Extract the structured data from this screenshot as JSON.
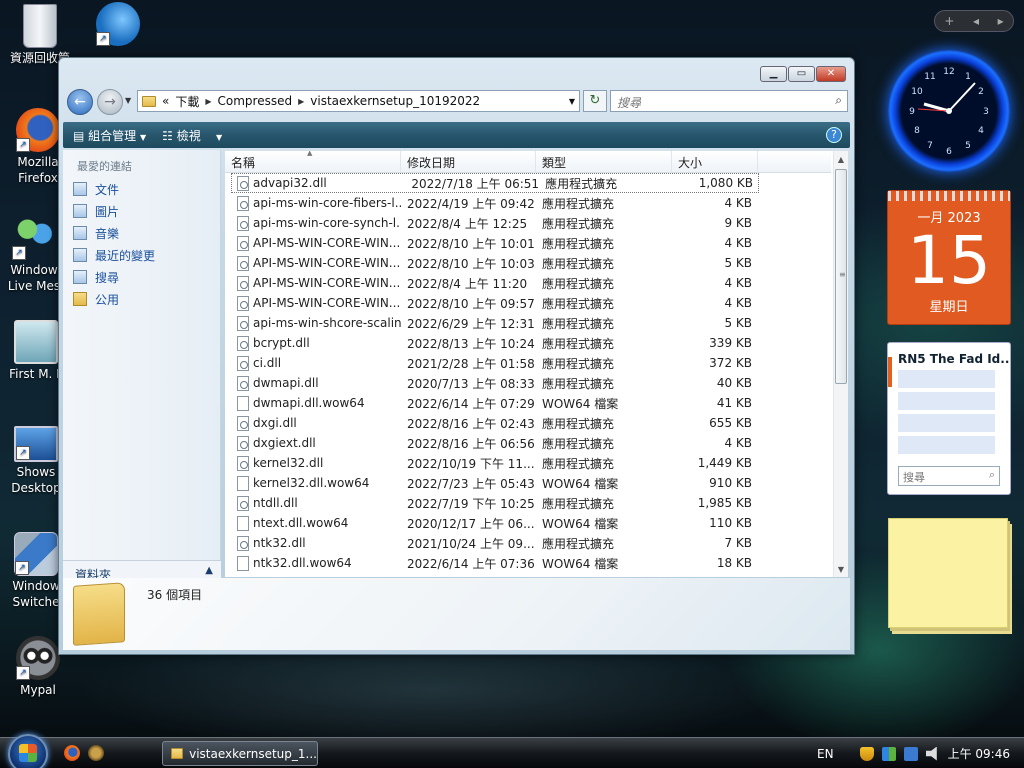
{
  "desktop": {
    "icons": [
      {
        "label": "資源回收筒",
        "icon": "recycle-bin-icon"
      },
      {
        "label": "",
        "icon": "internet-download-manager-icon"
      },
      {
        "label": "Mozilla\nFirefox",
        "icon": "firefox-icon"
      },
      {
        "label": "Window\nLive Mes",
        "icon": "messenger-icon"
      },
      {
        "label": "First M. L",
        "icon": "user-icon"
      },
      {
        "label": "Shows\nDesktop",
        "icon": "show-desktop-icon"
      },
      {
        "label": "Window\nSwitche",
        "icon": "window-switcher-icon"
      },
      {
        "label": "Mypal",
        "icon": "mypal-icon"
      }
    ]
  },
  "gadgets": {
    "calendar": {
      "month": "一月 2023",
      "day": "15",
      "weekday": "星期日"
    },
    "feed": {
      "title": "RN5 The Fad Id...",
      "search_placeholder": "搜尋"
    }
  },
  "window": {
    "breadcrumb": {
      "overflow": "«",
      "items": [
        "下載",
        "Compressed",
        "vistaexkernsetup_10192022"
      ]
    },
    "search_placeholder": "搜尋",
    "toolbar": {
      "organize": "組合管理",
      "views": "檢視",
      "help": "?"
    },
    "nav_pane": {
      "header": "最愛的連結",
      "links": [
        {
          "label": "文件",
          "icon": "documents-icon"
        },
        {
          "label": "圖片",
          "icon": "pictures-icon"
        },
        {
          "label": "音樂",
          "icon": "music-icon"
        },
        {
          "label": "最近的變更",
          "icon": "recent-changes-icon"
        },
        {
          "label": "搜尋",
          "icon": "search-folder-icon"
        },
        {
          "label": "公用",
          "icon": "public-folder-icon"
        }
      ],
      "folders_label": "資料夾"
    },
    "columns": [
      "名稱",
      "修改日期",
      "類型",
      "大小"
    ],
    "files": [
      {
        "name": "advapi32.dll",
        "date": "2022/7/18 上午 06:51",
        "type": "應用程式擴充",
        "size": "1,080 KB",
        "kind": "dll"
      },
      {
        "name": "api-ms-win-core-fibers-l...",
        "date": "2022/4/19 上午 09:42",
        "type": "應用程式擴充",
        "size": "4 KB",
        "kind": "dll"
      },
      {
        "name": "api-ms-win-core-synch-l...",
        "date": "2022/8/4 上午 12:25",
        "type": "應用程式擴充",
        "size": "9 KB",
        "kind": "dll"
      },
      {
        "name": "API-MS-WIN-CORE-WIN...",
        "date": "2022/8/10 上午 10:01",
        "type": "應用程式擴充",
        "size": "4 KB",
        "kind": "dll"
      },
      {
        "name": "API-MS-WIN-CORE-WIN...",
        "date": "2022/8/10 上午 10:03",
        "type": "應用程式擴充",
        "size": "5 KB",
        "kind": "dll"
      },
      {
        "name": "API-MS-WIN-CORE-WIN...",
        "date": "2022/8/4 上午 11:20",
        "type": "應用程式擴充",
        "size": "4 KB",
        "kind": "dll"
      },
      {
        "name": "API-MS-WIN-CORE-WIN...",
        "date": "2022/8/10 上午 09:57",
        "type": "應用程式擴充",
        "size": "4 KB",
        "kind": "dll"
      },
      {
        "name": "api-ms-win-shcore-scalin...",
        "date": "2022/6/29 上午 12:31",
        "type": "應用程式擴充",
        "size": "5 KB",
        "kind": "dll"
      },
      {
        "name": "bcrypt.dll",
        "date": "2022/8/13 上午 10:24",
        "type": "應用程式擴充",
        "size": "339 KB",
        "kind": "dll"
      },
      {
        "name": "ci.dll",
        "date": "2021/2/28 上午 01:58",
        "type": "應用程式擴充",
        "size": "372 KB",
        "kind": "dll"
      },
      {
        "name": "dwmapi.dll",
        "date": "2020/7/13 上午 08:33",
        "type": "應用程式擴充",
        "size": "40 KB",
        "kind": "dll"
      },
      {
        "name": "dwmapi.dll.wow64",
        "date": "2022/6/14 上午 07:29",
        "type": "WOW64 檔案",
        "size": "41 KB",
        "kind": "file"
      },
      {
        "name": "dxgi.dll",
        "date": "2022/8/16 上午 02:43",
        "type": "應用程式擴充",
        "size": "655 KB",
        "kind": "dll"
      },
      {
        "name": "dxgiext.dll",
        "date": "2022/8/16 上午 06:56",
        "type": "應用程式擴充",
        "size": "4 KB",
        "kind": "dll"
      },
      {
        "name": "kernel32.dll",
        "date": "2022/10/19 下午 11...",
        "type": "應用程式擴充",
        "size": "1,449 KB",
        "kind": "dll"
      },
      {
        "name": "kernel32.dll.wow64",
        "date": "2022/7/23 上午 05:43",
        "type": "WOW64 檔案",
        "size": "910 KB",
        "kind": "file"
      },
      {
        "name": "ntdll.dll",
        "date": "2022/7/19 下午 10:25",
        "type": "應用程式擴充",
        "size": "1,985 KB",
        "kind": "dll"
      },
      {
        "name": "ntext.dll.wow64",
        "date": "2020/12/17 上午 06...",
        "type": "WOW64 檔案",
        "size": "110 KB",
        "kind": "file"
      },
      {
        "name": "ntk32.dll",
        "date": "2021/10/24 上午 09...",
        "type": "應用程式擴充",
        "size": "7 KB",
        "kind": "dll"
      },
      {
        "name": "ntk32.dll.wow64",
        "date": "2022/6/14 上午 07:36",
        "type": "WOW64 檔案",
        "size": "18 KB",
        "kind": "file"
      }
    ],
    "status": {
      "item_count": "36 個項目"
    }
  },
  "taskbar": {
    "active_window": "vistaexkernsetup_1...",
    "language": "EN",
    "time": "上午 09:46"
  },
  "colors": {
    "accent": "#27566d",
    "link": "#1b4f9c",
    "calendar": "#e05a22"
  }
}
